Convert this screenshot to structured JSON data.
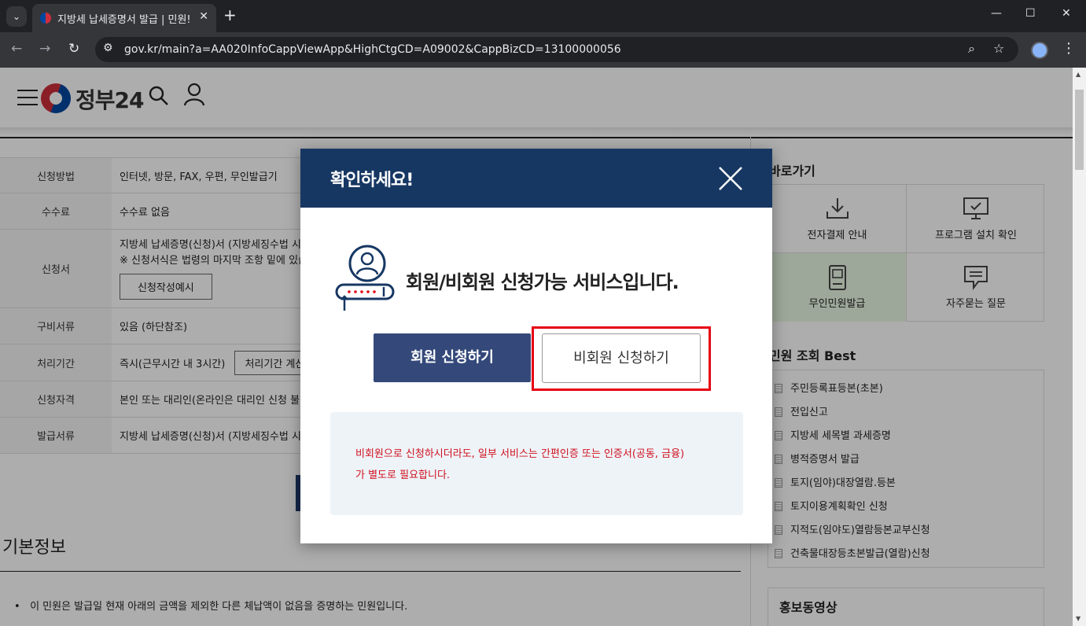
{
  "browser": {
    "tab_title": "지방세 납세증명서 발급 | 민원!",
    "url": "gov.kr/main?a=AA020InfoCappViewApp&HighCtgCD=A09002&CappBizCD=13100000056"
  },
  "site": {
    "logo_text": "정부24"
  },
  "info_table": {
    "rows": [
      {
        "label": "신청방법",
        "value": "인터넷, 방문, FAX, 우편, 무인발급기"
      },
      {
        "label": "수수료",
        "value": "수수료 없음"
      },
      {
        "label": "신청서",
        "value": "지방세 납세증명(신청)서 (지방세징수법 시",
        "value2": "※ 신청서식은 법령의 마지막 조항 밑에 있습",
        "button": "신청작성예시"
      },
      {
        "label": "구비서류",
        "value": "있음 (하단참조)"
      },
      {
        "label": "처리기간",
        "value": "즉시(근무시간 내 3시간)",
        "button": "처리기간 계산"
      },
      {
        "label": "신청자격",
        "value": "본인 또는 대리인(온라인은 대리인 신청 불"
      },
      {
        "label": "발급서류",
        "value": "지방세 납세증명(신청)서 (지방세징수법 시"
      }
    ]
  },
  "basic_info": {
    "title": "기본정보",
    "bullet": "이 민원은 발급일 현재 아래의 금액을 제외한 다른 체납액이 없음을 증명하는 민원입니다."
  },
  "sidebar": {
    "quick_title": "바로가기",
    "quick_items": [
      {
        "label": "전자결제 안내",
        "icon": "download-icon"
      },
      {
        "label": "프로그램 설치 확인",
        "icon": "monitor-check-icon"
      },
      {
        "label": "무인민원발급",
        "icon": "kiosk-icon"
      },
      {
        "label": "자주묻는 질문",
        "icon": "speech-bubble-icon"
      }
    ],
    "best_title": "민원 조회 Best",
    "best_items": [
      "주민등록표등본(초본)",
      "전입신고",
      "지방세 세목별 과세증명",
      "병적증명서 발급",
      "토지(임야)대장열람.등본",
      "토지이용계획확인 신청",
      "지적도(임야도)열람등본교부신청",
      "건축물대장등초본발급(열람)신청"
    ],
    "promo_title": "홍보동영상"
  },
  "modal": {
    "title": "확인하세요!",
    "message": "회원/비회원 신청가능 서비스입니다.",
    "member_button": "회원 신청하기",
    "guest_button": "비회원 신청하기",
    "notice_line1": "비회원으로 신청하시더라도, 일부 서비스는 간편인증 또는 인증서(공동, 금융)",
    "notice_line2": "가 별도로 필요합니다."
  },
  "colors": {
    "modal_header": "#173763",
    "member_button": "#34497a",
    "notice_text": "#d0101e",
    "highlight_frame": "#e60012",
    "kiosk_cell_bg": "#e9f8e4"
  }
}
